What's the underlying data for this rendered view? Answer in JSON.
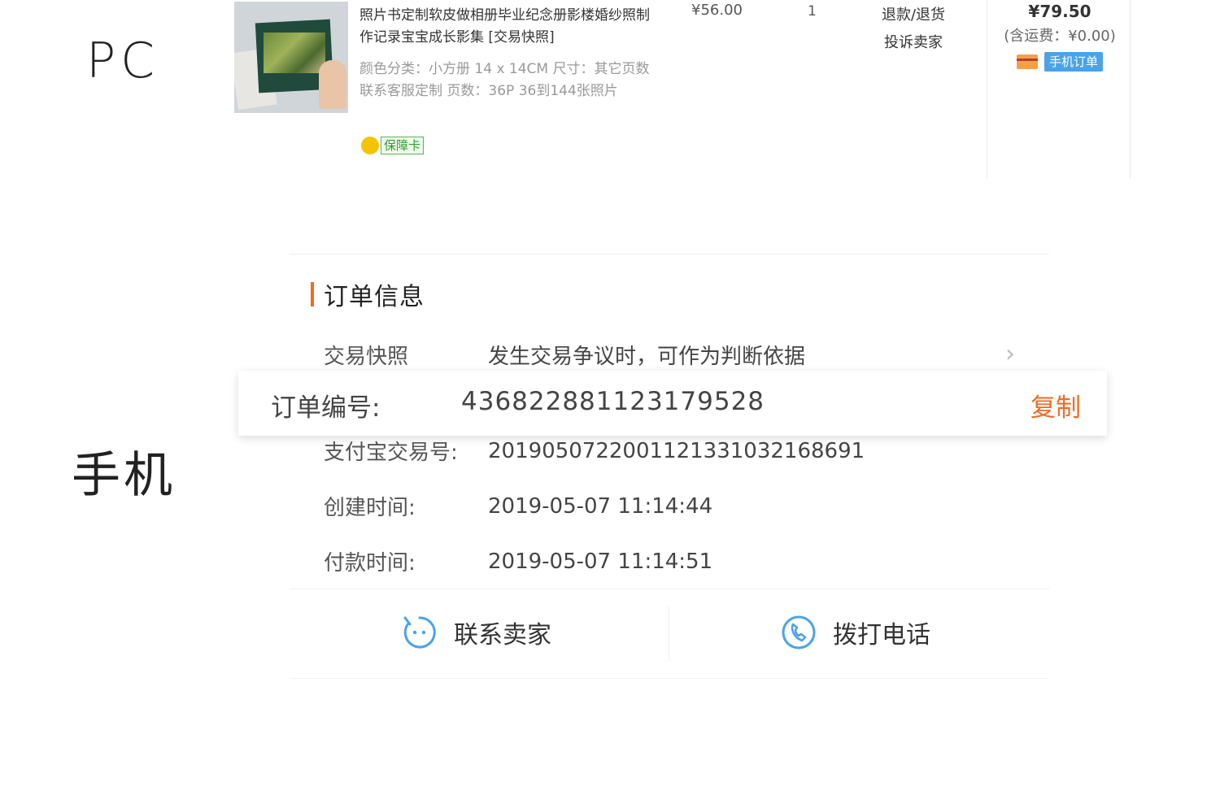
{
  "labels": {
    "pc": "PC",
    "mobile": "手机"
  },
  "pc_order": {
    "title": "照片书定制软皮做相册毕业纪念册影楼婚纱照制作记录宝宝成长影集 [交易快照]",
    "meta": "颜色分类：小方册 14 x 14CM  尺寸：其它页数联系客服定制  页数：36P 36到144张照片",
    "guarantee": "保障卡",
    "unit_price": "¥56.00",
    "quantity": "1",
    "actions": [
      "退款/退货",
      "投诉卖家"
    ],
    "total": "¥79.50",
    "shipping": "(含运费：¥0.00)",
    "mobile_order_badge": "手机订单"
  },
  "mobile": {
    "section_title": "订单信息",
    "snapshot": {
      "key": "交易快照",
      "value": "发生交易争议时，可作为判断依据"
    },
    "order_no": {
      "key": "订单编号:",
      "value": "436822881123179528",
      "copy_label": "复制"
    },
    "alipay": {
      "key": "支付宝交易号:",
      "value": "2019050722001121331032168691"
    },
    "created": {
      "key": "创建时间:",
      "value": "2019-05-07 11:14:44"
    },
    "paid": {
      "key": "付款时间:",
      "value": "2019-05-07 11:14:51"
    },
    "contact_seller": "联系卖家",
    "call_phone": "拨打电话"
  },
  "colors": {
    "accent": "#ef6c23",
    "icon_blue": "#4aa3e8",
    "badge_blue": "#4aa3e8"
  },
  "icons": [
    "guarantee-icon",
    "card-icon",
    "chevron-right-icon",
    "chat-icon",
    "phone-icon"
  ]
}
